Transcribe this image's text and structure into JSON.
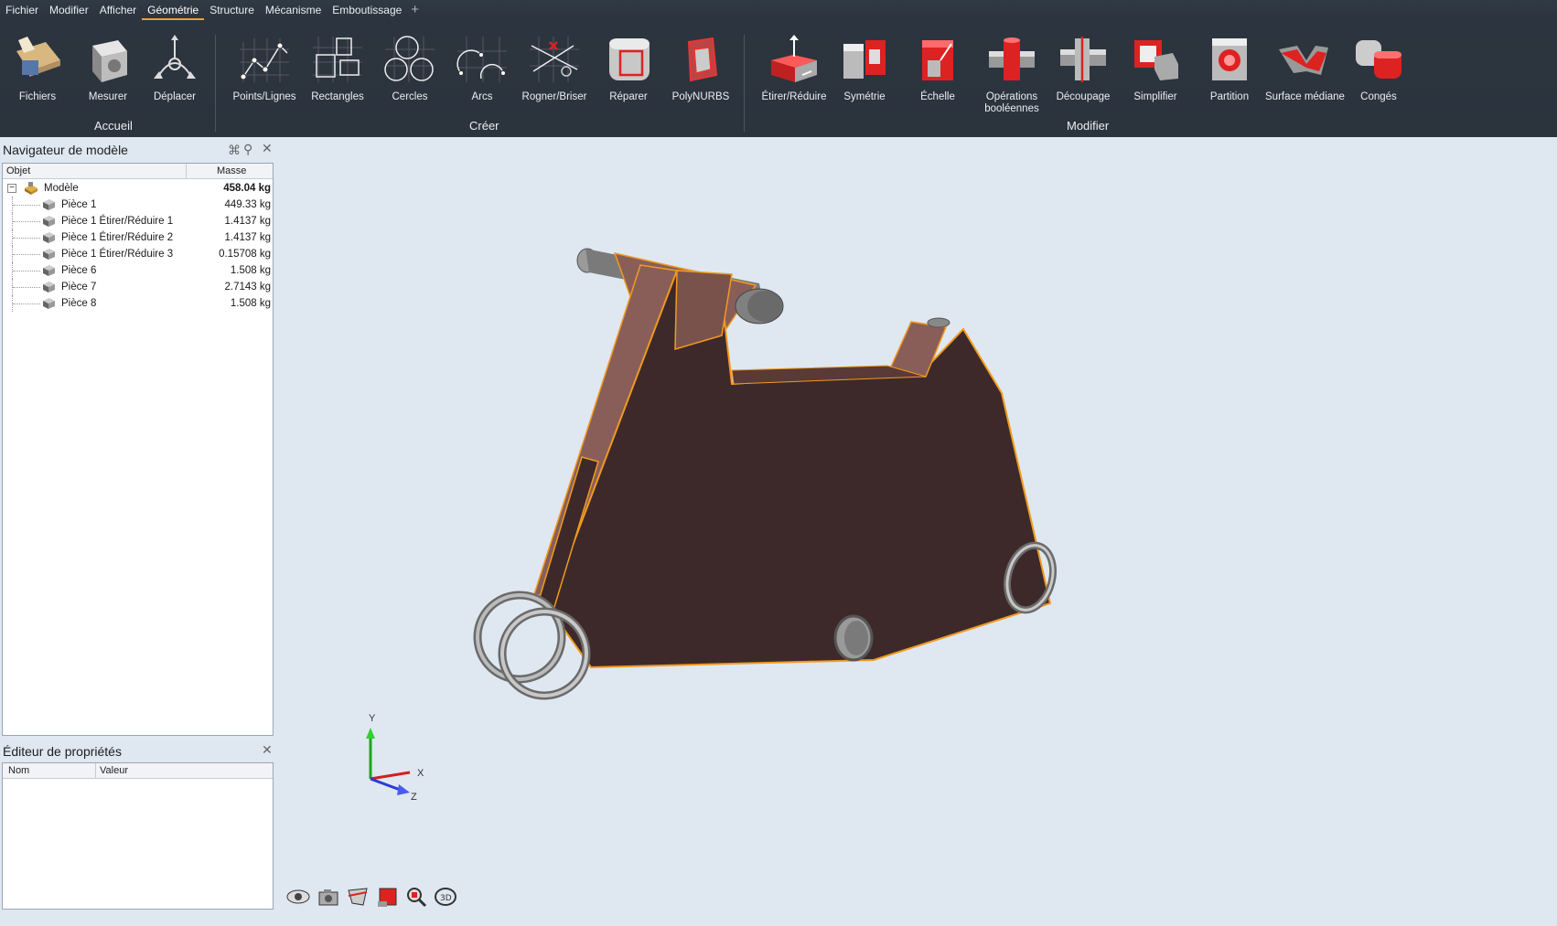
{
  "menu": {
    "items": [
      "Fichier",
      "Modifier",
      "Afficher",
      "Géométrie",
      "Structure",
      "Mécanisme",
      "Emboutissage"
    ],
    "active": "Géométrie"
  },
  "ribbon": {
    "tools": [
      "Fichiers",
      "Mesurer",
      "Déplacer",
      "Points/Lignes",
      "Rectangles",
      "Cercles",
      "Arcs",
      "Rogner/Briser",
      "Réparer",
      "PolyNURBS",
      "Étirer/Réduire",
      "Symétrie",
      "Échelle",
      "Opérations booléennes",
      "Découpage",
      "Simplifier",
      "Partition",
      "Surface médiane",
      "Congés"
    ],
    "groups": [
      "Accueil",
      "Créer",
      "Modifier"
    ]
  },
  "navigator": {
    "title": "Navigateur de modèle",
    "col_object": "Objet",
    "col_mass": "Masse",
    "root": {
      "name": "Modèle",
      "mass": "458.04 kg"
    },
    "items": [
      {
        "name": "Pièce 1",
        "mass": "449.33 kg"
      },
      {
        "name": "Pièce 1 Étirer/Réduire 1",
        "mass": "1.4137 kg"
      },
      {
        "name": "Pièce 1 Étirer/Réduire 2",
        "mass": "1.4137 kg"
      },
      {
        "name": "Pièce 1 Étirer/Réduire 3",
        "mass": "0.15708 kg"
      },
      {
        "name": "Pièce 6",
        "mass": "1.508 kg"
      },
      {
        "name": "Pièce 7",
        "mass": "2.7143 kg"
      },
      {
        "name": "Pièce 8",
        "mass": "1.508 kg"
      }
    ]
  },
  "properties": {
    "title": "Éditeur de propriétés",
    "col_name": "Nom",
    "col_value": "Valeur"
  },
  "axes": {
    "y": "Y",
    "x": "X",
    "z": "Z"
  },
  "colors": {
    "ribbon": "#2c353f",
    "viewport": "#dfe8f1",
    "model_face": "#3d2929",
    "model_light": "#8a5e58",
    "highlight": "#f09a20",
    "accent_red": "#e03030"
  }
}
